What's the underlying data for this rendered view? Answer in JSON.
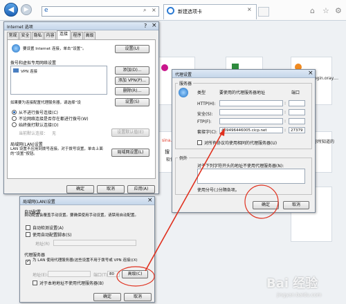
{
  "browser": {
    "tab_title": "新建选项卡",
    "address": ""
  },
  "background_tiles": {
    "texts": [
      "ogin.oray....",
      "sina.com.cn",
      "软件",
      "你所知道的",
      "搜"
    ]
  },
  "internet_options": {
    "title": "Internet 选项",
    "tabs": [
      "常规",
      "安全",
      "隐私",
      "内容",
      "连接",
      "程序",
      "高级"
    ],
    "setup_text": "要设置 Internet 连接，单击“设置”。",
    "setup_button": "设置(U)",
    "dialup_header": "拨号和虚拟专用网络设置",
    "list_item": "VPN 连接",
    "add_button": "添加(D)...",
    "add_vpn_button": "添加 VPN(P)...",
    "delete_button": "删除(R)...",
    "settings_text": "如果要为连接配置代理服务器，请选择“设",
    "settings_button": "设置(S)",
    "radio_never": "从不进行拨号连接(C)",
    "radio_when_no_network": "不论网络连接是否存在都进行拨号(W)",
    "radio_always": "始终拨打默认连接(O)",
    "current_default_label": "当前默认连接：",
    "current_default_value": "无",
    "set_default_button": "设置默认值(E)",
    "lan_header": "局域网(LAN)设置",
    "lan_text": "LAN 设置不应用到拨号连接。对于拨号设置，单击上面的“设置”按钮。",
    "lan_button": "局域网设置(L)",
    "ok": "确定",
    "cancel": "取消",
    "apply": "应用(A)"
  },
  "lan_settings": {
    "title": "局域网(LAN)设置",
    "auto_header": "自动配置",
    "auto_desc": "自动配置会覆盖手动设置。要确保使用手动设置，请禁用自动配置。",
    "auto_detect": "自动检测设置(A)",
    "use_script": "使用自动配置脚本(S)",
    "address_label": "地址(R)",
    "proxy_header": "代理服务器",
    "use_proxy": "为 LAN 使用代理服务器(这些设置不用于拨号或 VPN 连接)(X)",
    "proxy_address_label": "地址(E):",
    "port_label": "端口(T):",
    "port_value": "80",
    "advanced_button": "高级(C)",
    "bypass_local": "对于本地地址不使用代理服务器(B)",
    "ok": "确定",
    "cancel": "取消"
  },
  "proxy_settings": {
    "title": "代理设置",
    "servers_header": "服务器",
    "col_type": "类型",
    "col_address": "要使用的代理服务器地址",
    "col_port": "端口",
    "rows": [
      {
        "label": "HTTP(H):",
        "address": "",
        "port": ""
      },
      {
        "label": "安全(S):",
        "address": "",
        "port": ""
      },
      {
        "label": "FTP(F):",
        "address": "",
        "port": ""
      },
      {
        "label": "套接字(C):",
        "address": "469496446005.cicp.net",
        "port": "27379"
      }
    ],
    "same_proxy": "对所有协议均使用相同的代理服务器(U)",
    "exceptions_header": "例外",
    "exceptions_text": "对于下列字符开头的地址不使用代理服务器(N):",
    "exceptions_value": "",
    "separator_note": "使用分号(;)分隔各项。",
    "ok": "确定",
    "cancel": "取消"
  },
  "watermark": {
    "text": "Bai 经验",
    "sub": "jingyan.baidu.com"
  },
  "colors": {
    "annotation_red": "#e0301e",
    "title_bar": "#c5d6ea"
  }
}
